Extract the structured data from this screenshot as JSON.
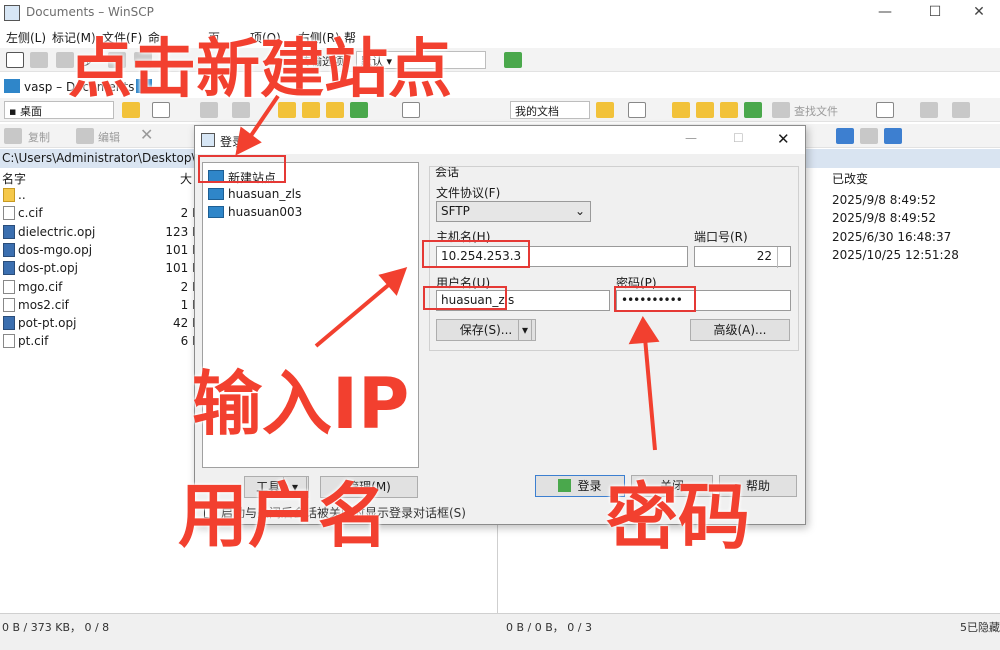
{
  "window": {
    "title": "Documents – WinSCP"
  },
  "menu": [
    {
      "label": "左侧(L)"
    },
    {
      "label": "标记(M)"
    },
    {
      "label": "文件(F)"
    },
    {
      "label": "命"
    },
    {
      "label": "页"
    },
    {
      "label": "项(O)"
    },
    {
      "label": "右侧(R)"
    },
    {
      "label": "帮"
    }
  ],
  "toolbar1": {
    "sync_label": "步",
    "transfer_label": "传输选项",
    "default_label": "默认"
  },
  "tabs": {
    "session_tab": "vasp – Documents"
  },
  "left_toolbar": {
    "location": "桌面",
    "copy": "复制",
    "edit": "编辑"
  },
  "right_toolbar": {
    "location": "我的文档",
    "find": "查找文件"
  },
  "left_pane": {
    "path": "C:\\Users\\Administrator\\Desktop\\va",
    "col_name": "名字",
    "col_size": "大",
    "files": [
      {
        "name": "..",
        "size": "",
        "type": "up"
      },
      {
        "name": "c.cif",
        "size": "2 K",
        "type": "file"
      },
      {
        "name": "dielectric.opj",
        "size": "123 K",
        "type": "opj"
      },
      {
        "name": "dos-mgo.opj",
        "size": "101 K",
        "type": "opj"
      },
      {
        "name": "dos-pt.opj",
        "size": "101 K",
        "type": "opj"
      },
      {
        "name": "mgo.cif",
        "size": "2 K",
        "type": "file"
      },
      {
        "name": "mos2.cif",
        "size": "1 K",
        "type": "file"
      },
      {
        "name": "pot-pt.opj",
        "size": "42 K",
        "type": "opj"
      },
      {
        "name": "pt.cif",
        "size": "6 K",
        "type": "file"
      }
    ],
    "status": "0 B / 373 KB，  0 / 8"
  },
  "right_pane": {
    "col_changed": "已改变",
    "dates": [
      "2025/9/8 8:49:52",
      "2025/9/8 8:49:52",
      "2025/6/30 16:48:37",
      "2025/10/25 12:51:28"
    ],
    "status": "0 B / 0 B，  0 / 3",
    "hidden": "5已隐藏"
  },
  "dialog": {
    "title": "登录",
    "sites": [
      {
        "label": "新建站点"
      },
      {
        "label": "huasuan_zls"
      },
      {
        "label": "huasuan003"
      }
    ],
    "session_group": "会话",
    "protocol_label": "文件协议(F)",
    "protocol_value": "SFTP",
    "host_label": "主机名(H)",
    "host_value": "10.254.253.3",
    "port_label": "端口号(R)",
    "port_value": "22",
    "user_label": "用户名(U)",
    "user_value": "huasuan_zls",
    "password_label": "密码(P)",
    "password_value": "••••••••••",
    "save_button": "保存(S)...",
    "advanced_button": "高级(A)...",
    "tools_button": "工具(T)",
    "manage_button": "管理(M)",
    "checkbox_label": "启动与关闭后会话被关闭时显示登录对话框(S)",
    "login_button": "登录",
    "close_button": "关闭",
    "help_button": "帮助"
  },
  "annotations": {
    "new_site": "点击新建站点",
    "enter_ip": "输入IP",
    "username": "用户名",
    "password": "密码"
  }
}
